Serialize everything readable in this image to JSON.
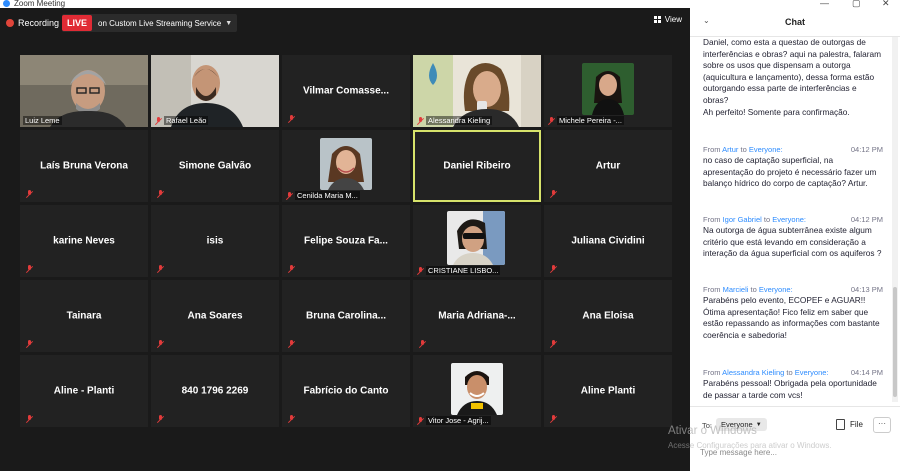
{
  "window": {
    "title": "Zoom Meeting"
  },
  "toolbar": {
    "recording_label": "Recording",
    "live_badge": "LIVE",
    "live_text": "on Custom Live Streaming Service",
    "view_label": "View"
  },
  "tiles": [
    {
      "name": "Luiz Leme"
    },
    {
      "name": "Rafael Leão"
    },
    {
      "name": "Vilmar  Comasse..."
    },
    {
      "name": "Alessandra Kieling"
    },
    {
      "name": "Michele Pereira -..."
    },
    {
      "name": "Laís Bruna Verona"
    },
    {
      "name": "Simone Galvão"
    },
    {
      "name": "Cenilda Maria M..."
    },
    {
      "name": "Daniel Ribeiro"
    },
    {
      "name": "Artur"
    },
    {
      "name": "karine Neves"
    },
    {
      "name": "isis"
    },
    {
      "name": "Felipe  Souza  Fa..."
    },
    {
      "name": "CRISTIANE LISBO..."
    },
    {
      "name": "Juliana Cividini"
    },
    {
      "name": "Tainara"
    },
    {
      "name": "Ana Soares"
    },
    {
      "name": "Bruna  Carolina..."
    },
    {
      "name": "Maria  Adriana-..."
    },
    {
      "name": "Ana Eloisa"
    },
    {
      "name": "Aline - Planti"
    },
    {
      "name": "840 1796 2269"
    },
    {
      "name": "Fabrício do Canto"
    },
    {
      "name": "Vitor Jose - Agrij..."
    },
    {
      "name": "Aline Planti"
    }
  ],
  "chat": {
    "title": "Chat",
    "messages": [
      {
        "text": "Daniel, como esta a questao de outorgas de interferências e obras? aqui na palestra, falaram sobre os usos que dispensam a outorga (aquicultura e lançamento), dessa forma estão outorgando essa parte de interferências e obras?\nAh perfeito! Somente para confirmação."
      },
      {
        "from": "From",
        "sender": "Artur",
        "to": "to",
        "recipient": "Everyone:",
        "time": "04:12 PM",
        "text": "no caso de captação superficial, na apresentação do projeto é necessário fazer um balanço hídrico do corpo de captação? Artur."
      },
      {
        "from": "From",
        "sender": "Igor Gabriel",
        "to": "to",
        "recipient": "Everyone:",
        "time": "04:12 PM",
        "text": "Na outorga de água subterrânea existe algum critério  que está levando em consideração a interação da água superficial com os aquiferos ?"
      },
      {
        "from": "From",
        "sender": "Marcieli",
        "to": "to",
        "recipient": "Everyone:",
        "time": "04:13 PM",
        "text": "Parabéns pelo evento, ECOPEF e AGUAR!! Ótima apresentação! Fico feliz em saber que estão repassando as informações com bastante coerência e sabedoria!"
      },
      {
        "from": "From",
        "sender": "Alessandra Kieling",
        "to": "to",
        "recipient": "Everyone:",
        "time": "04:14 PM",
        "text": "Parabéns pessoal! Obrigada pela oportunidade de passar a tarde com vcs!"
      }
    ],
    "to_label": "To:",
    "to_value": "Everyone",
    "file_label": "File",
    "more_label": "···",
    "input_placeholder": "Type message here..."
  },
  "watermark": {
    "line1": "Ativar o Windows",
    "line2": "Acesse Configurações para ativar o Windows."
  },
  "colors": {
    "accent": "#2d8cff",
    "live": "#e02b35",
    "active_border": "#d7e36b",
    "mute": "#e23b3b"
  }
}
